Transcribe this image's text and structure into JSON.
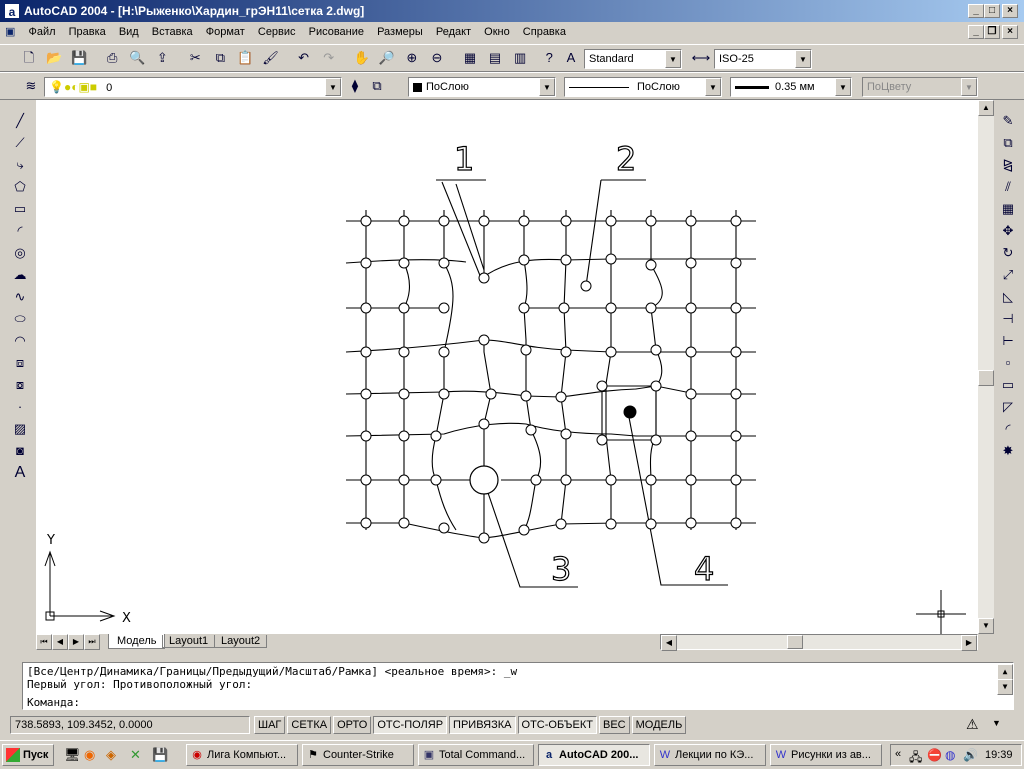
{
  "window": {
    "title": "AutoCAD 2004 - [H:\\Рыженко\\Хардин_грЭН11\\сетка 2.dwg]"
  },
  "menu": [
    "Файл",
    "Правка",
    "Вид",
    "Вставка",
    "Формат",
    "Сервис",
    "Рисование",
    "Размеры",
    "Редакт",
    "Окно",
    "Справка"
  ],
  "toolbar": {
    "text_style": "Standard",
    "dim_style": "ISO-25",
    "layer": "0",
    "color": "ПоСлою",
    "linetype": "ПоСлою",
    "lineweight": "0.35 мм",
    "plotstyle": "ПоЦвету"
  },
  "drawing": {
    "labels": [
      "1",
      "2",
      "3",
      "4"
    ],
    "ucs": {
      "x": "X",
      "y": "Y"
    }
  },
  "tabs": [
    "Модель",
    "Layout1",
    "Layout2"
  ],
  "command": {
    "line1": "[Все/Центр/Динамика/Границы/Предыдущий/Масштаб/Рамка] <реальное время>: _w",
    "line2": "Первый угол: Противоположный угол:",
    "prompt": "Команда:"
  },
  "status": {
    "coords": "738.5893, 109.3452, 0.0000",
    "buttons": [
      "ШАГ",
      "СЕТКА",
      "ОРТО",
      "ОТС-ПОЛЯР",
      "ПРИВЯЗКА",
      "ОТС-ОБЪЕКТ",
      "ВЕС",
      "МОДЕЛЬ"
    ]
  },
  "taskbar": {
    "start": "Пуск",
    "tasks": [
      "Лига Компьют...",
      "Counter-Strike",
      "Total Command...",
      "AutoCAD 200...",
      "Лекции по КЭ...",
      "Рисунки из ав..."
    ],
    "clock": "19:39"
  }
}
